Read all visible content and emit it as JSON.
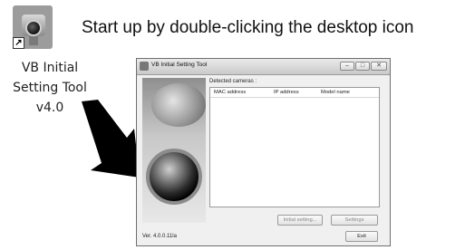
{
  "desktop_icon": {
    "label_line1": "VB Initial",
    "label_line2": "Setting Tool",
    "label_line3": "v4.0",
    "icon": "camera-shortcut-icon"
  },
  "instruction": "Start up by double-clicking the desktop icon",
  "window": {
    "title": "VB Initial Setting Tool",
    "controls": {
      "minimize": "–",
      "maximize": "□",
      "close": "✕"
    },
    "detected_label": "Detected cameras :",
    "table": {
      "columns": [
        "MAC address",
        "IP address",
        "Model name"
      ],
      "rows": []
    },
    "buttons": {
      "initial_setting": "Initial setting...",
      "settings": "Settings",
      "exit": "Exit"
    },
    "version": "Ver. 4.0.0.11la"
  }
}
